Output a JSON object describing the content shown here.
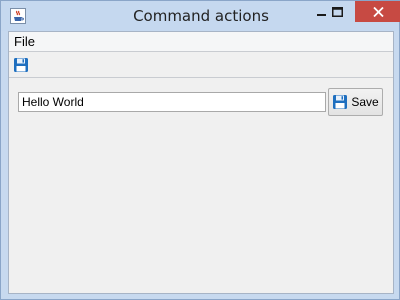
{
  "window": {
    "title": "Command actions",
    "app_icon": "java-coffee-cup-icon"
  },
  "controls": {
    "minimize_icon": "minimize-icon",
    "maximize_icon": "maximize-icon",
    "close_icon": "close-icon",
    "close_color": "#c74a43"
  },
  "menubar": {
    "items": [
      {
        "label": "File"
      }
    ]
  },
  "toolbar": {
    "save_icon": "floppy-disk-icon"
  },
  "content": {
    "text_value": "Hello World",
    "save_label": "Save",
    "save_icon": "floppy-disk-icon"
  },
  "colors": {
    "floppy_blue": "#1f6fbf",
    "titlebar": "#c5d8ef"
  }
}
